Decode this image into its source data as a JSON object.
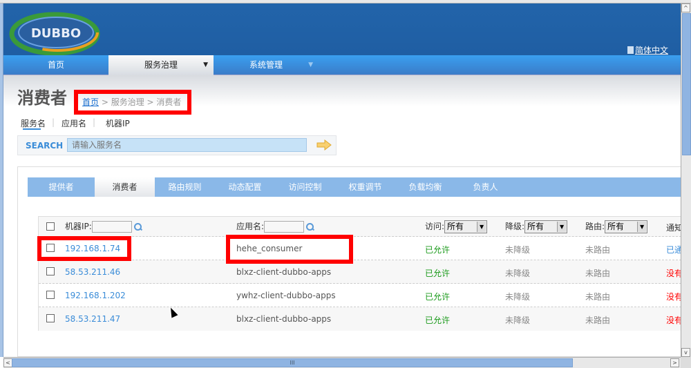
{
  "header": {
    "logo_text": "DUBBO",
    "language_link": "简体中文"
  },
  "nav": [
    {
      "label": "首页"
    },
    {
      "label": "服务治理",
      "caret": "▼"
    },
    {
      "label": "系统管理",
      "caret": "▼"
    }
  ],
  "page": {
    "title": "消费者",
    "breadcrumb": {
      "home": "首页",
      "sep1": " > 服务治理 > 消费者"
    }
  },
  "search_tabs": [
    "服务名",
    "应用名",
    "机器IP"
  ],
  "search": {
    "label": "SEARCH",
    "placeholder": "请输入服务名"
  },
  "tabs": [
    "提供者",
    "消费者",
    "路由规则",
    "动态配置",
    "访问控制",
    "权重调节",
    "负载均衡",
    "负责人"
  ],
  "table": {
    "header": {
      "ip_label": "机器IP:",
      "app_label": "应用名:",
      "access_label": "访问:",
      "access_value": "所有",
      "degrade_label": "降级:",
      "degrade_value": "所有",
      "route_label": "路由:",
      "route_value": "所有",
      "notify_label": "通知"
    },
    "rows": [
      {
        "ip": "192.168.1.74",
        "app": "hehe_consumer",
        "access": "已允许",
        "degrade": "未降级",
        "route": "未路由",
        "notify": "已通"
      },
      {
        "ip": "58.53.211.46",
        "app": "blxz-client-dubbo-apps",
        "access": "已允许",
        "degrade": "未降级",
        "route": "未路由",
        "notify": "没有"
      },
      {
        "ip": "192.168.1.202",
        "app": "ywhz-client-dubbo-apps",
        "access": "已允许",
        "degrade": "未降级",
        "route": "未路由",
        "notify": "没有"
      },
      {
        "ip": "58.53.211.47",
        "app": "blxz-client-dubbo-apps",
        "access": "已允许",
        "degrade": "未降级",
        "route": "未路由",
        "notify": "没有"
      }
    ]
  },
  "scrollbar": {
    "grip": "III"
  }
}
